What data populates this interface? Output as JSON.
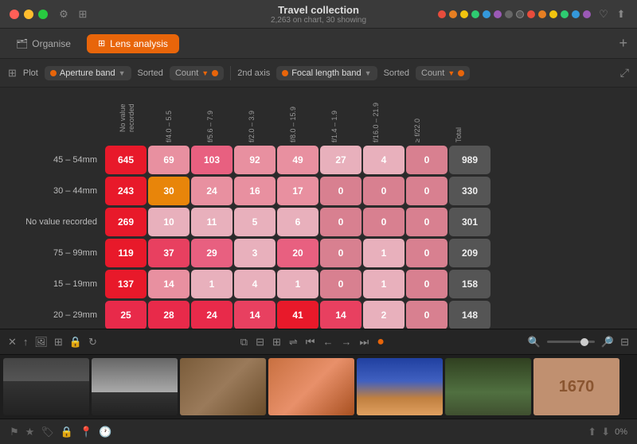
{
  "titlebar": {
    "title": "Travel collection",
    "subtitle": "2,263 on chart, 30 showing",
    "icons": [
      "gear-icon",
      "stack-icon"
    ]
  },
  "topbar": {
    "organise_label": "Organise",
    "lens_analysis_label": "Lens analysis",
    "plus_label": "+"
  },
  "toolbar": {
    "plot_label": "Plot",
    "x_axis_label": "Aperture band",
    "sorted_label": "Sorted",
    "count_label": "Count",
    "axis_2nd_label": "2nd axis",
    "y_axis_label": "Focal length band",
    "sorted2_label": "Sorted",
    "count2_label": "Count"
  },
  "matrix": {
    "col_headers": [
      "No value recorded",
      "f/4.0 – 5.5",
      "f/5.6 – 7.9",
      "f/2.0 – 3.9",
      "f/8.0 – 15.9",
      "f/1.4 – 1.9",
      "f/16.0 – 21.9",
      "≥ f/22.0",
      "Total"
    ],
    "rows": [
      {
        "label": "45 – 54mm",
        "cells": [
          645,
          69,
          103,
          92,
          49,
          27,
          4,
          0,
          989
        ],
        "is_total": [
          false,
          false,
          false,
          false,
          false,
          false,
          false,
          false,
          true
        ]
      },
      {
        "label": "30 – 44mm",
        "cells": [
          243,
          30,
          24,
          16,
          17,
          0,
          0,
          0,
          330
        ],
        "is_total": [
          false,
          false,
          false,
          false,
          false,
          false,
          false,
          false,
          true
        ]
      },
      {
        "label": "No value recorded",
        "cells": [
          269,
          10,
          11,
          5,
          6,
          0,
          0,
          0,
          301
        ],
        "is_total": [
          false,
          false,
          false,
          false,
          false,
          false,
          false,
          false,
          true
        ]
      },
      {
        "label": "75 – 99mm",
        "cells": [
          119,
          37,
          29,
          3,
          20,
          0,
          1,
          0,
          209
        ],
        "is_total": [
          false,
          false,
          false,
          false,
          false,
          false,
          false,
          false,
          true
        ]
      },
      {
        "label": "15 – 19mm",
        "cells": [
          137,
          14,
          1,
          4,
          1,
          0,
          1,
          0,
          158
        ],
        "is_total": [
          false,
          false,
          false,
          false,
          false,
          false,
          false,
          false,
          true
        ]
      },
      {
        "label": "20 – 29mm",
        "cells": [
          25,
          28,
          24,
          14,
          41,
          14,
          2,
          0,
          148
        ],
        "is_total": [
          false,
          false,
          false,
          false,
          false,
          false,
          false,
          false,
          true
        ]
      }
    ]
  },
  "cell_colors": {
    "high": "#e8324a",
    "medium_high": "#e84060",
    "medium": "#e85878",
    "medium_low": "#e87090",
    "low": "#e898b0",
    "very_low": "#e8c0cc",
    "zero": "#e8d8dc",
    "highlight_orange": "#e8850a"
  },
  "photo_strip": {
    "toolbar_icons": [
      "close",
      "sort-ascending",
      "image",
      "grid-small",
      "lock",
      "rotation"
    ],
    "center_icons": [
      "copy",
      "grid",
      "grid-alt",
      "shuffle",
      "skip-start",
      "arrow-left",
      "arrow-right",
      "skip-end",
      "play"
    ],
    "right_icons": [
      "zoom-out",
      "zoom-in",
      "grid-small"
    ],
    "thumbnails": [
      {
        "type": "bw-landscape",
        "label": "Black and white landscape"
      },
      {
        "type": "bw-tree",
        "label": "Black and white tree"
      },
      {
        "type": "door-brown",
        "label": "Brown wooden door"
      },
      {
        "type": "door-orange",
        "label": "Orange door window"
      },
      {
        "type": "sunset",
        "label": "Sunset ocean"
      },
      {
        "type": "forest",
        "label": "Forest green"
      },
      {
        "type": "numbers",
        "label": "Numbers 1670"
      }
    ]
  },
  "status_bar": {
    "icons": [
      "flag",
      "star",
      "label",
      "lock",
      "location",
      "clock"
    ],
    "right_icons": [
      "share",
      "export"
    ],
    "percent": "0%"
  }
}
